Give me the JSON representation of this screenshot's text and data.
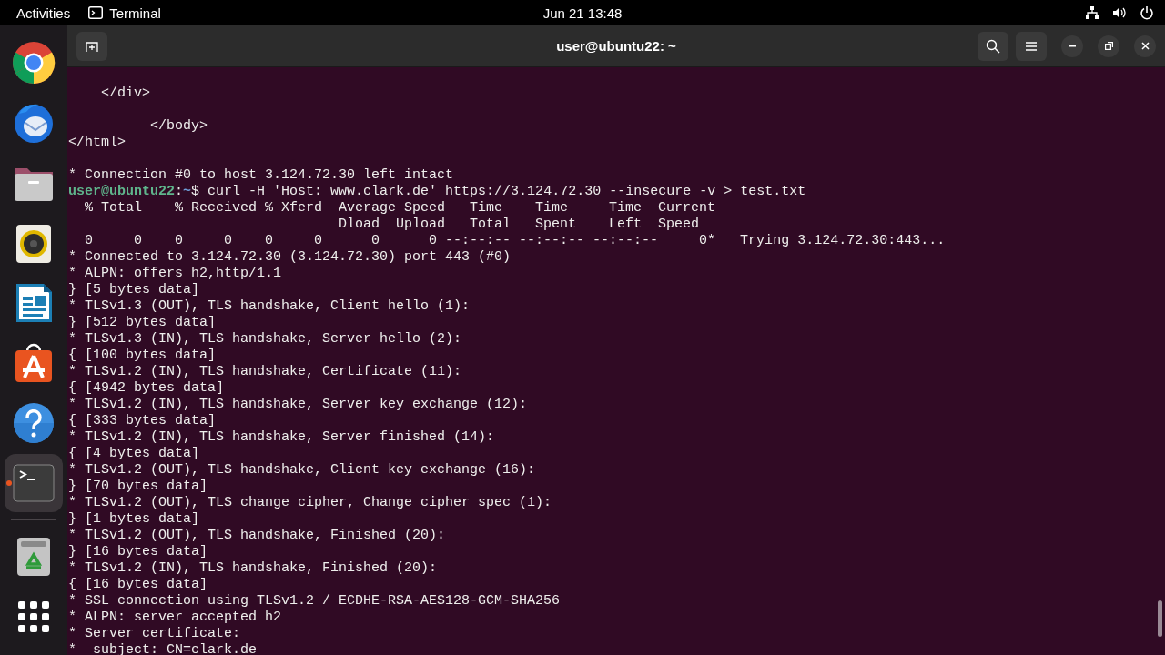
{
  "top_bar": {
    "activities": "Activities",
    "app_name": "Terminal",
    "clock": "Jun 21  13:48"
  },
  "dock": [
    {
      "kind": "chrome",
      "running": false
    },
    {
      "kind": "mail",
      "running": false
    },
    {
      "kind": "files",
      "running": false
    },
    {
      "kind": "speaker",
      "running": false
    },
    {
      "kind": "writer",
      "running": false
    },
    {
      "kind": "store",
      "running": false
    },
    {
      "kind": "help",
      "running": false
    },
    {
      "kind": "terminal",
      "running": true
    },
    {
      "kind": "trash",
      "running": false
    },
    {
      "kind": "apps",
      "running": false
    }
  ],
  "window": {
    "title": "user@ubuntu22: ~"
  },
  "terminal_lines": [
    {
      "kind": "text",
      "text": "    </div>"
    },
    {
      "kind": "blank"
    },
    {
      "kind": "text",
      "text": "          </body>"
    },
    {
      "kind": "text",
      "text": "</html>"
    },
    {
      "kind": "blank"
    },
    {
      "kind": "text",
      "text": "* Connection #0 to host 3.124.72.30 left intact"
    },
    {
      "kind": "prompt",
      "segments": [
        {
          "kind": "user",
          "text": "user@ubuntu22"
        },
        {
          "kind": "plain",
          "text": ":"
        },
        {
          "kind": "path",
          "text": "~"
        },
        {
          "kind": "plain",
          "text": "$ curl -H 'Host: www.clark.de' https://3.124.72.30 --insecure -v > test.txt"
        }
      ]
    },
    {
      "kind": "text",
      "text": "  % Total    % Received % Xferd  Average Speed   Time    Time     Time  Current"
    },
    {
      "kind": "text",
      "text": "                                 Dload  Upload   Total   Spent    Left  Speed"
    },
    {
      "kind": "text",
      "text": "  0     0    0     0    0     0      0      0 --:--:-- --:--:-- --:--:--     0*   Trying 3.124.72.30:443..."
    },
    {
      "kind": "text",
      "text": "* Connected to 3.124.72.30 (3.124.72.30) port 443 (#0)"
    },
    {
      "kind": "text",
      "text": "* ALPN: offers h2,http/1.1"
    },
    {
      "kind": "text",
      "text": "} [5 bytes data]"
    },
    {
      "kind": "text",
      "text": "* TLSv1.3 (OUT), TLS handshake, Client hello (1):"
    },
    {
      "kind": "text",
      "text": "} [512 bytes data]"
    },
    {
      "kind": "text",
      "text": "* TLSv1.3 (IN), TLS handshake, Server hello (2):"
    },
    {
      "kind": "text",
      "text": "{ [100 bytes data]"
    },
    {
      "kind": "text",
      "text": "* TLSv1.2 (IN), TLS handshake, Certificate (11):"
    },
    {
      "kind": "text",
      "text": "{ [4942 bytes data]"
    },
    {
      "kind": "text",
      "text": "* TLSv1.2 (IN), TLS handshake, Server key exchange (12):"
    },
    {
      "kind": "text",
      "text": "{ [333 bytes data]"
    },
    {
      "kind": "text",
      "text": "* TLSv1.2 (IN), TLS handshake, Server finished (14):"
    },
    {
      "kind": "text",
      "text": "{ [4 bytes data]"
    },
    {
      "kind": "text",
      "text": "* TLSv1.2 (OUT), TLS handshake, Client key exchange (16):"
    },
    {
      "kind": "text",
      "text": "} [70 bytes data]"
    },
    {
      "kind": "text",
      "text": "* TLSv1.2 (OUT), TLS change cipher, Change cipher spec (1):"
    },
    {
      "kind": "text",
      "text": "} [1 bytes data]"
    },
    {
      "kind": "text",
      "text": "* TLSv1.2 (OUT), TLS handshake, Finished (20):"
    },
    {
      "kind": "text",
      "text": "} [16 bytes data]"
    },
    {
      "kind": "text",
      "text": "* TLSv1.2 (IN), TLS handshake, Finished (20):"
    },
    {
      "kind": "text",
      "text": "{ [16 bytes data]"
    },
    {
      "kind": "text",
      "text": "* SSL connection using TLSv1.2 / ECDHE-RSA-AES128-GCM-SHA256"
    },
    {
      "kind": "text",
      "text": "* ALPN: server accepted h2"
    },
    {
      "kind": "text",
      "text": "* Server certificate:"
    },
    {
      "kind": "text",
      "text": "*  subject: CN=clark.de"
    }
  ]
}
